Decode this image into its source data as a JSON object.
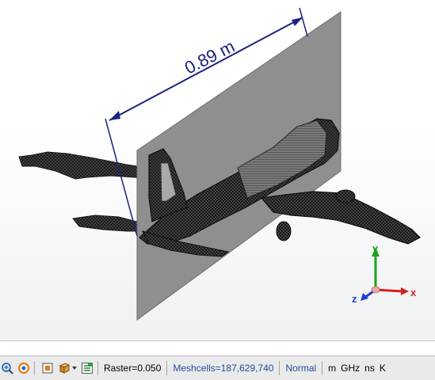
{
  "viewport": {
    "dimension_label": "0.89 m",
    "axes": {
      "x": "x",
      "y": "y",
      "z": "z"
    },
    "colors": {
      "dimension_line": "#1a237e",
      "plane": "#8f8f8f",
      "mesh": "#2b2b2b",
      "x_axis": "#d62020",
      "y_axis": "#1ea31e",
      "z_axis": "#1f3fd0"
    }
  },
  "statusbar": {
    "icons": [
      "zoom-icon",
      "rotate-icon",
      "fit-view-icon",
      "cube-view-icon",
      "cube-dropdown-icon",
      "mesh-view-icon"
    ],
    "raster": "Raster=0.050",
    "meshcells": "Meshcells=187,629,740",
    "mode": "Normal",
    "units": [
      "m",
      "GHz",
      "ns",
      "K"
    ]
  }
}
